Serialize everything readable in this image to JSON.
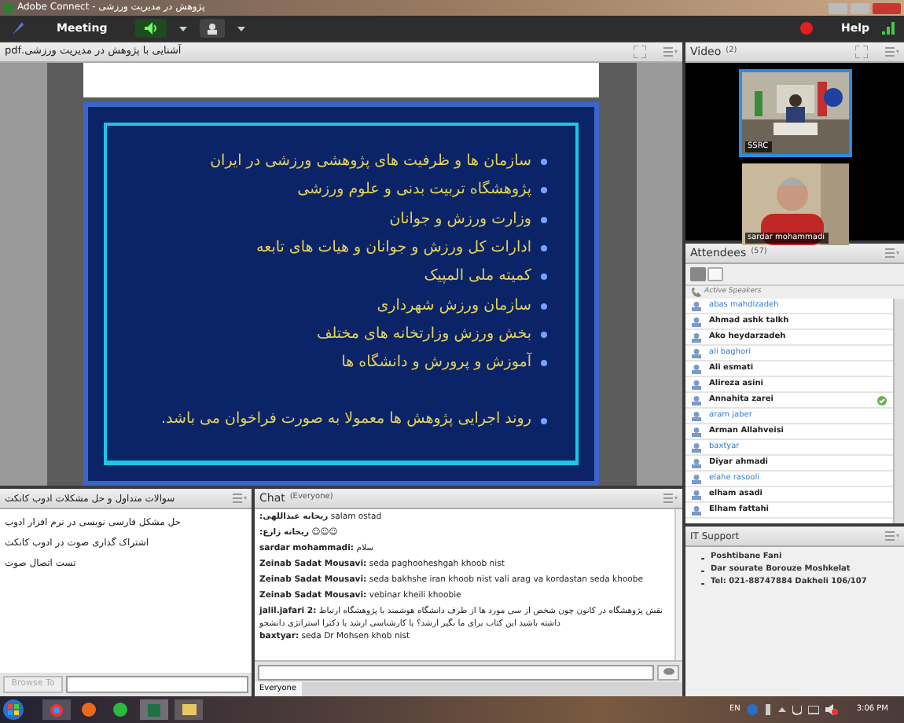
{
  "window": {
    "title": "پژوهش در مدیریت ورزشی - Adobe Connect"
  },
  "menu_bar": {
    "menu": "Meeting",
    "help": "Help",
    "speaker_on": true,
    "recording": true
  },
  "share_pod": {
    "title": "آشنایی با پژوهش در مدیریت ورزشی.pdf",
    "slide": {
      "bullets": [
        "سازمان ها و ظرفیت های پژوهشی ورزشی در ایران",
        "پژوهشگاه تربیت بدنی و علوم ورزشی",
        "وزارت ورزش و جوانان",
        "ادارات کل ورزش و جوانان و هیات های تابعه",
        "کمیته ملی المپیک",
        "سازمان ورزش شهرداری",
        "بخش ورزش وزارتخانه های مختلف",
        "آموزش و پرورش و دانشگاه ها"
      ],
      "note": "روند اجرایی پژوهش ها معمولا به صورت فراخوان می باشد."
    }
  },
  "video_pod": {
    "title": "Video",
    "count": "(2)",
    "feeds": [
      {
        "label": "SSRC",
        "selected": true
      },
      {
        "label": "sardar mohammadi",
        "selected": false
      }
    ]
  },
  "attendees_pod": {
    "title": "Attendees",
    "count": "(57)",
    "section": "Active Speakers",
    "attendees": [
      {
        "name": "abas mahdizadeh",
        "kind": "host",
        "agreed": false
      },
      {
        "name": "Ahmad ashk talkh",
        "kind": "participant",
        "agreed": false
      },
      {
        "name": "Ako heydarzadeh",
        "kind": "participant",
        "agreed": false
      },
      {
        "name": "ali baghori",
        "kind": "host",
        "agreed": false
      },
      {
        "name": "Ali esmati",
        "kind": "participant",
        "agreed": false
      },
      {
        "name": "Alireza asini",
        "kind": "participant",
        "agreed": false
      },
      {
        "name": "Annahita zarei",
        "kind": "participant",
        "agreed": true
      },
      {
        "name": "aram jaber",
        "kind": "host",
        "agreed": false
      },
      {
        "name": "Arman Allahveisi",
        "kind": "participant",
        "agreed": false
      },
      {
        "name": "baxtyar",
        "kind": "host",
        "agreed": false
      },
      {
        "name": "Diyar ahmadi",
        "kind": "participant",
        "agreed": false
      },
      {
        "name": "elahe rasooli",
        "kind": "host",
        "agreed": false
      },
      {
        "name": "elham asadi",
        "kind": "participant",
        "agreed": false
      },
      {
        "name": "Elham fattahi",
        "kind": "participant",
        "agreed": false
      }
    ]
  },
  "faq_pod": {
    "title": "سوالات متداول و حل مشکلات ادوب کانکت",
    "items": [
      "حل مشکل فارسی نویسی در نرم افزار ادوب",
      "اشتراک گذاری صوت در ادوب کانکت",
      "تست اتصال صوت"
    ],
    "browse_button": {
      "label": "Browse To",
      "disabled": true
    }
  },
  "chat_pod": {
    "title": "Chat",
    "scope": "(Everyone)",
    "tab": "Everyone",
    "messages": [
      {
        "sender": "ریحانه عبداللهی:",
        "text": "salam ostad"
      },
      {
        "sender": "ریحانه زارع:",
        "text": "☺☺☺"
      },
      {
        "sender": "sardar mohammadi:",
        "text": "سلام"
      },
      {
        "sender": "Zeinab Sadat Mousavi:",
        "text": "seda paghooheshgah khoob nist"
      },
      {
        "sender": "Zeinab Sadat Mousavi:",
        "text": "seda  bakhshe iran khoob nist vali arag va kordastan seda khoobe"
      },
      {
        "sender": "Zeinab Sadat Mousavi:",
        "text": "vebinar kheili khoobie"
      },
      {
        "sender": "jalil.jafari 2:",
        "text": "نقش پژوهشگاه در کانون چون شخص از سی مورد ها از طرف دانشگاه هوشمند با پژوهشگاه ارتباط داشته باشید این کتاب برای ما بگیر ارشد؟ یا کارشناسی ارشد یا دکترا استراتژی دانشجو"
      },
      {
        "sender": "baxtyar:",
        "text": "seda Dr Mohsen khob nist"
      }
    ]
  },
  "it_support_pod": {
    "title": "IT Support",
    "lines": [
      "Poshtibane Fani",
      "Dar sourate Borouze Moshkelat",
      "Tel: 021-88747884 Dakheli 106/107"
    ]
  },
  "taskbar": {
    "language": "EN",
    "time": "3:06 PM"
  }
}
